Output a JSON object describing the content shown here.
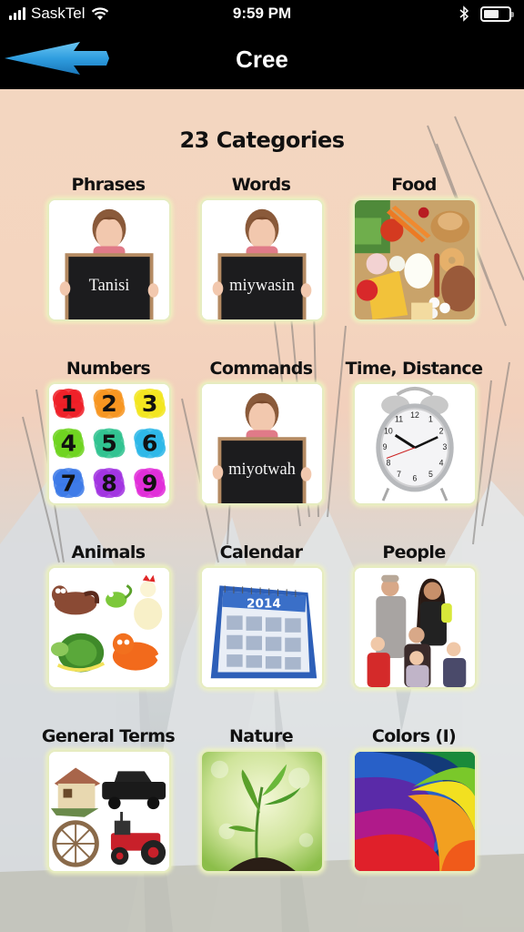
{
  "status_bar": {
    "carrier": "SaskTel",
    "time": "9:59 PM",
    "signal_bars": 4,
    "battery_percent": 60,
    "icons": [
      "signal-icon",
      "wifi-icon",
      "bluetooth-icon",
      "battery-icon"
    ]
  },
  "nav": {
    "title": "Cree",
    "back_icon": "blue-arrow-left-icon"
  },
  "main": {
    "count_title": "23 Categories",
    "categories": [
      {
        "label": "Phrases",
        "image": "girl-chalkboard",
        "board_text": "Tanisi"
      },
      {
        "label": "Words",
        "image": "girl-chalkboard",
        "board_text": "miywasin"
      },
      {
        "label": "Food",
        "image": "food-assortment"
      },
      {
        "label": "Numbers",
        "image": "colorful-numbers",
        "digits": [
          "1",
          "2",
          "3",
          "4",
          "5",
          "6",
          "7",
          "8",
          "9"
        ]
      },
      {
        "label": "Commands",
        "image": "girl-chalkboard",
        "board_text": "miyotwah"
      },
      {
        "label": "Time, Distance",
        "image": "alarm-clock"
      },
      {
        "label": "Animals",
        "image": "cartoon-animals"
      },
      {
        "label": "Calendar",
        "image": "desk-calendar",
        "year": "2014"
      },
      {
        "label": "People",
        "image": "family-photo"
      },
      {
        "label": "General Terms",
        "image": "house-truck-wheel-tractor"
      },
      {
        "label": "Nature",
        "image": "sprouting-plant"
      },
      {
        "label": "Colors (I)",
        "image": "rainbow-swirl"
      }
    ]
  }
}
